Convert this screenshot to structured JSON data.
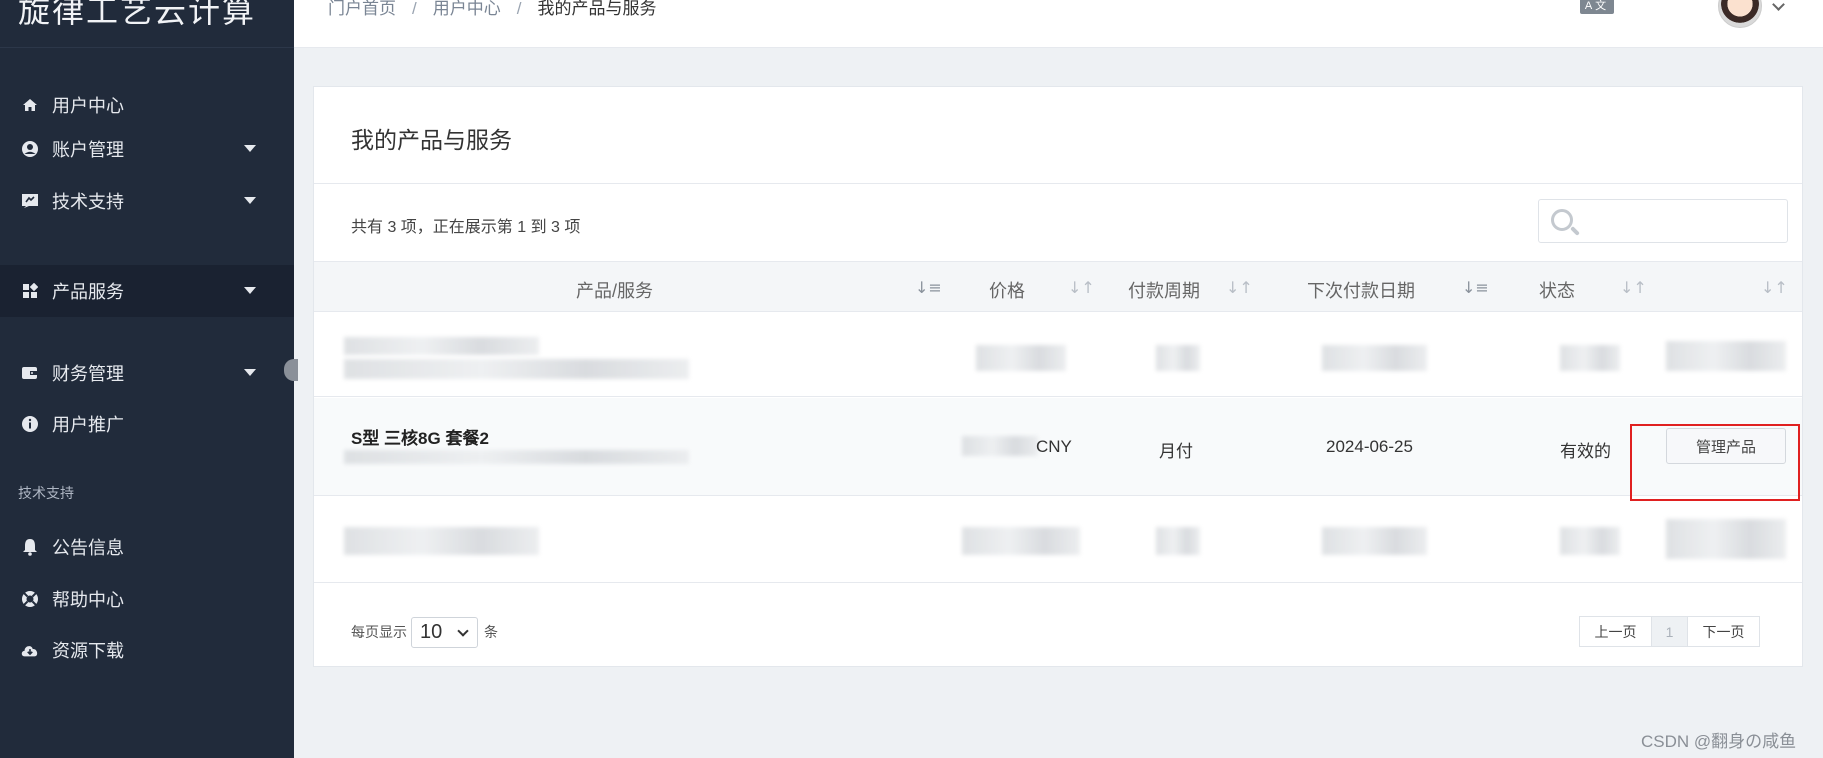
{
  "sidebar": {
    "brand": "旋律工艺云计算",
    "items": [
      {
        "label": "用户中心",
        "icon": "home-icon"
      },
      {
        "label": "账户管理",
        "icon": "user-circle-icon"
      },
      {
        "label": "技术支持",
        "icon": "ticket-icon"
      },
      {
        "label": "产品服务",
        "icon": "grid-icon"
      },
      {
        "label": "财务管理",
        "icon": "wallet-icon"
      },
      {
        "label": "用户推广",
        "icon": "info-icon"
      }
    ],
    "section_label": "技术支持",
    "support_items": [
      {
        "label": "公告信息",
        "icon": "bell-icon"
      },
      {
        "label": "帮助中心",
        "icon": "lifebuoy-icon"
      },
      {
        "label": "资源下载",
        "icon": "cloud-download-icon"
      }
    ]
  },
  "header": {
    "breadcrumb": [
      "门户首页",
      "用户中心",
      "我的产品与服务"
    ],
    "translate_icon": "A文"
  },
  "main": {
    "title": "我的产品与服务",
    "info": "共有 3 项，正在展示第 1 到 3 项",
    "columns": [
      "产品/服务",
      "价格",
      "付款周期",
      "下次付款日期",
      "状态"
    ],
    "row2": {
      "product": "S型 三核8G 套餐2",
      "price_suffix": "CNY",
      "cycle": "月付",
      "next_date": "2024-06-25",
      "status": "有效的",
      "action": "管理产品"
    },
    "per_page_label": "每页显示",
    "per_page_value": "10",
    "per_page_unit": "条",
    "pagination": {
      "prev": "上一页",
      "current": "1",
      "next": "下一页"
    }
  },
  "watermark": "CSDN @翻身の咸鱼",
  "colors": {
    "sidebar": "#212b3b",
    "highlight": "#e02020"
  }
}
